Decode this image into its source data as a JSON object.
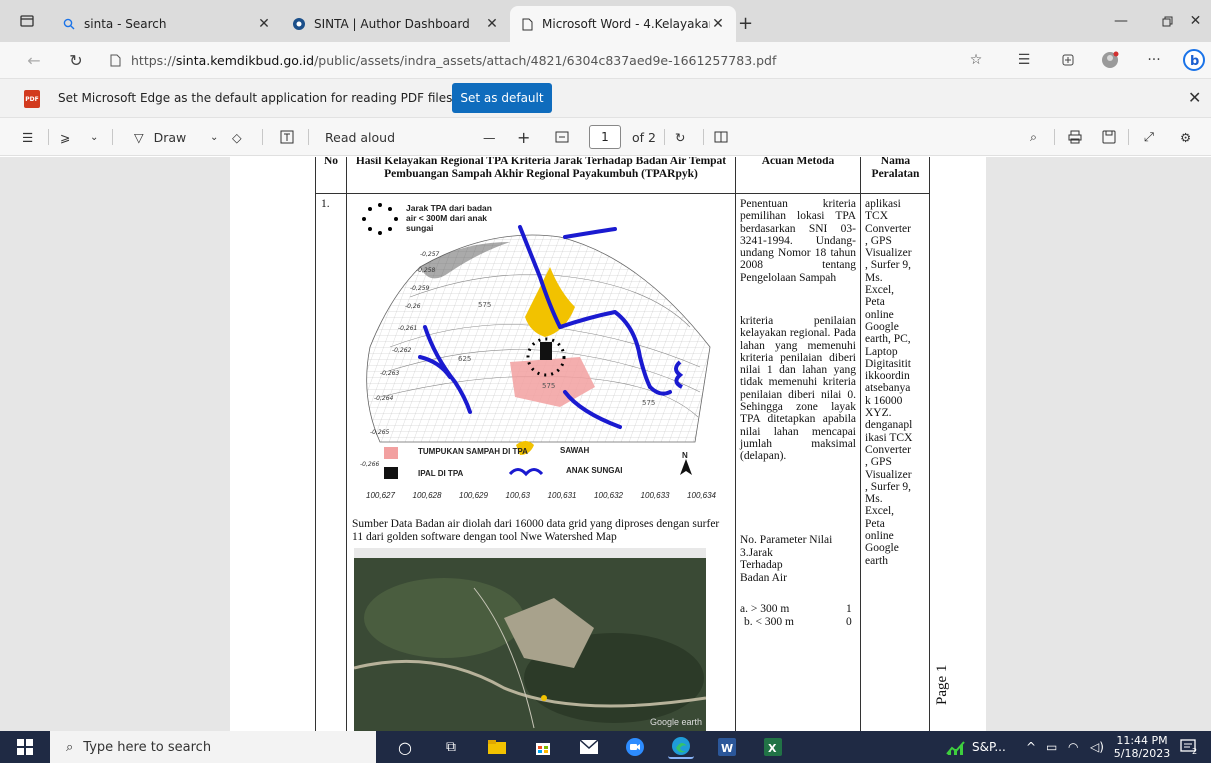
{
  "tabs": [
    {
      "label": "sinta - Search",
      "icon": "search-icon"
    },
    {
      "label": "SINTA | Author Dashboard",
      "icon": "sinta-logo-icon"
    },
    {
      "label": "Microsoft Word - 4.Kelayakan Re",
      "icon": "document-icon"
    }
  ],
  "address": {
    "prefix": "https://",
    "host": "sinta.kemdikbud.go.id",
    "path": "/public/assets/indra_assets/attach/4821/6304c837aed9e-1661257783.pdf"
  },
  "infobar": {
    "message": "Set Microsoft Edge as the default application for reading PDF files?",
    "button": "Set as default"
  },
  "pdf_toolbar": {
    "draw": "Draw",
    "read_aloud": "Read aloud",
    "page": "1",
    "of_pages": "of 2"
  },
  "document": {
    "header_no": "No",
    "header_main": "Hasil Kelayakan Regional TPA Kriteria Jarak Terhadap Badan Air Tempat Pembuangan Sampah Akhir Regional Payakumbuh (TPARpyk)",
    "header_method": "Acuan Metoda",
    "header_tools": "Nama Peralatan",
    "row_no": "1.",
    "map_legend": {
      "dotted": "Jarak TPA dari badan air < 300M dari anak sungai",
      "pile": "TUMPUKAN SAMPAH DI TPA",
      "rice": "SAWAH",
      "ipal": "IPAL DI TPA",
      "river": "ANAK SUNGAI",
      "north": "N"
    },
    "y_ticks": [
      "-0,257",
      "-0,258",
      "-0,259",
      "-0,26",
      "-0,261",
      "-0,262",
      "-0,263",
      "-0,264",
      "-0,265",
      "-0,266"
    ],
    "x_ticks": [
      "100,627",
      "100,628",
      "100,629",
      "100,63",
      "100,631",
      "100,632",
      "100,633",
      "100,634"
    ],
    "contour_labels": [
      "575",
      "625",
      "575",
      "575"
    ],
    "source_text": "Sumber Data Badan air diolah dari 16000 data grid yang diproses dengan surfer 11 dari golden software dengan tool Nwe Watershed Map",
    "satellite_watermark": "Google earth",
    "method_text": "Penentuan kriteria pemilihan lokasi TPA berdasarkan SNI 03-3241-1994. Undang-undang Nomor 18 tahun 2008 tentang Pengelolaan Sampah",
    "method_text2": "kriteria penilaian kelayakan regional. Pada lahan yang memenuhi kriteria penilaian diberi nilai 1 dan lahan yang tidak memenuhi kriteria penilaian diberi nilai 0. Sehingga zone layak TPA ditetapkan apabila nilai lahan mencapai jumlah maksimal (delapan).",
    "param_header": "No. Parameter Nilai",
    "param_name": "3.Jarak\nTerhadap\nBadan Air",
    "param_a": "a. > 300 m",
    "param_a_val": "1",
    "param_b": "b. < 300 m",
    "param_b_val": "0",
    "tools_text": "aplikasi\nTCX\nConverter\n, GPS\nVisualizer\n, Surfer 9,\nMs.\nExcel,\nPeta\nonline\nGoogle\nearth, PC,\nLaptop\nDigitasitit\nikkoordin\natsebanya\nk 16000\nXYZ.\ndenganapl\nikasi TCX\nConverter\n, GPS\nVisualizer\n, Surfer 9,\nMs.\nExcel,\nPeta\nonline\nGoogle\nearth",
    "page_label": "Page 1"
  },
  "taskbar": {
    "search_placeholder": "Type here to search",
    "tray_label": "S&P...",
    "time": "11:44 PM",
    "date": "5/18/2023",
    "notif_count": "2"
  },
  "colors": {
    "river": "#1a1ad0",
    "rice_field": "#f2c200",
    "waste_pile": "#f2a0a0",
    "accent": "#0f6cbd"
  }
}
